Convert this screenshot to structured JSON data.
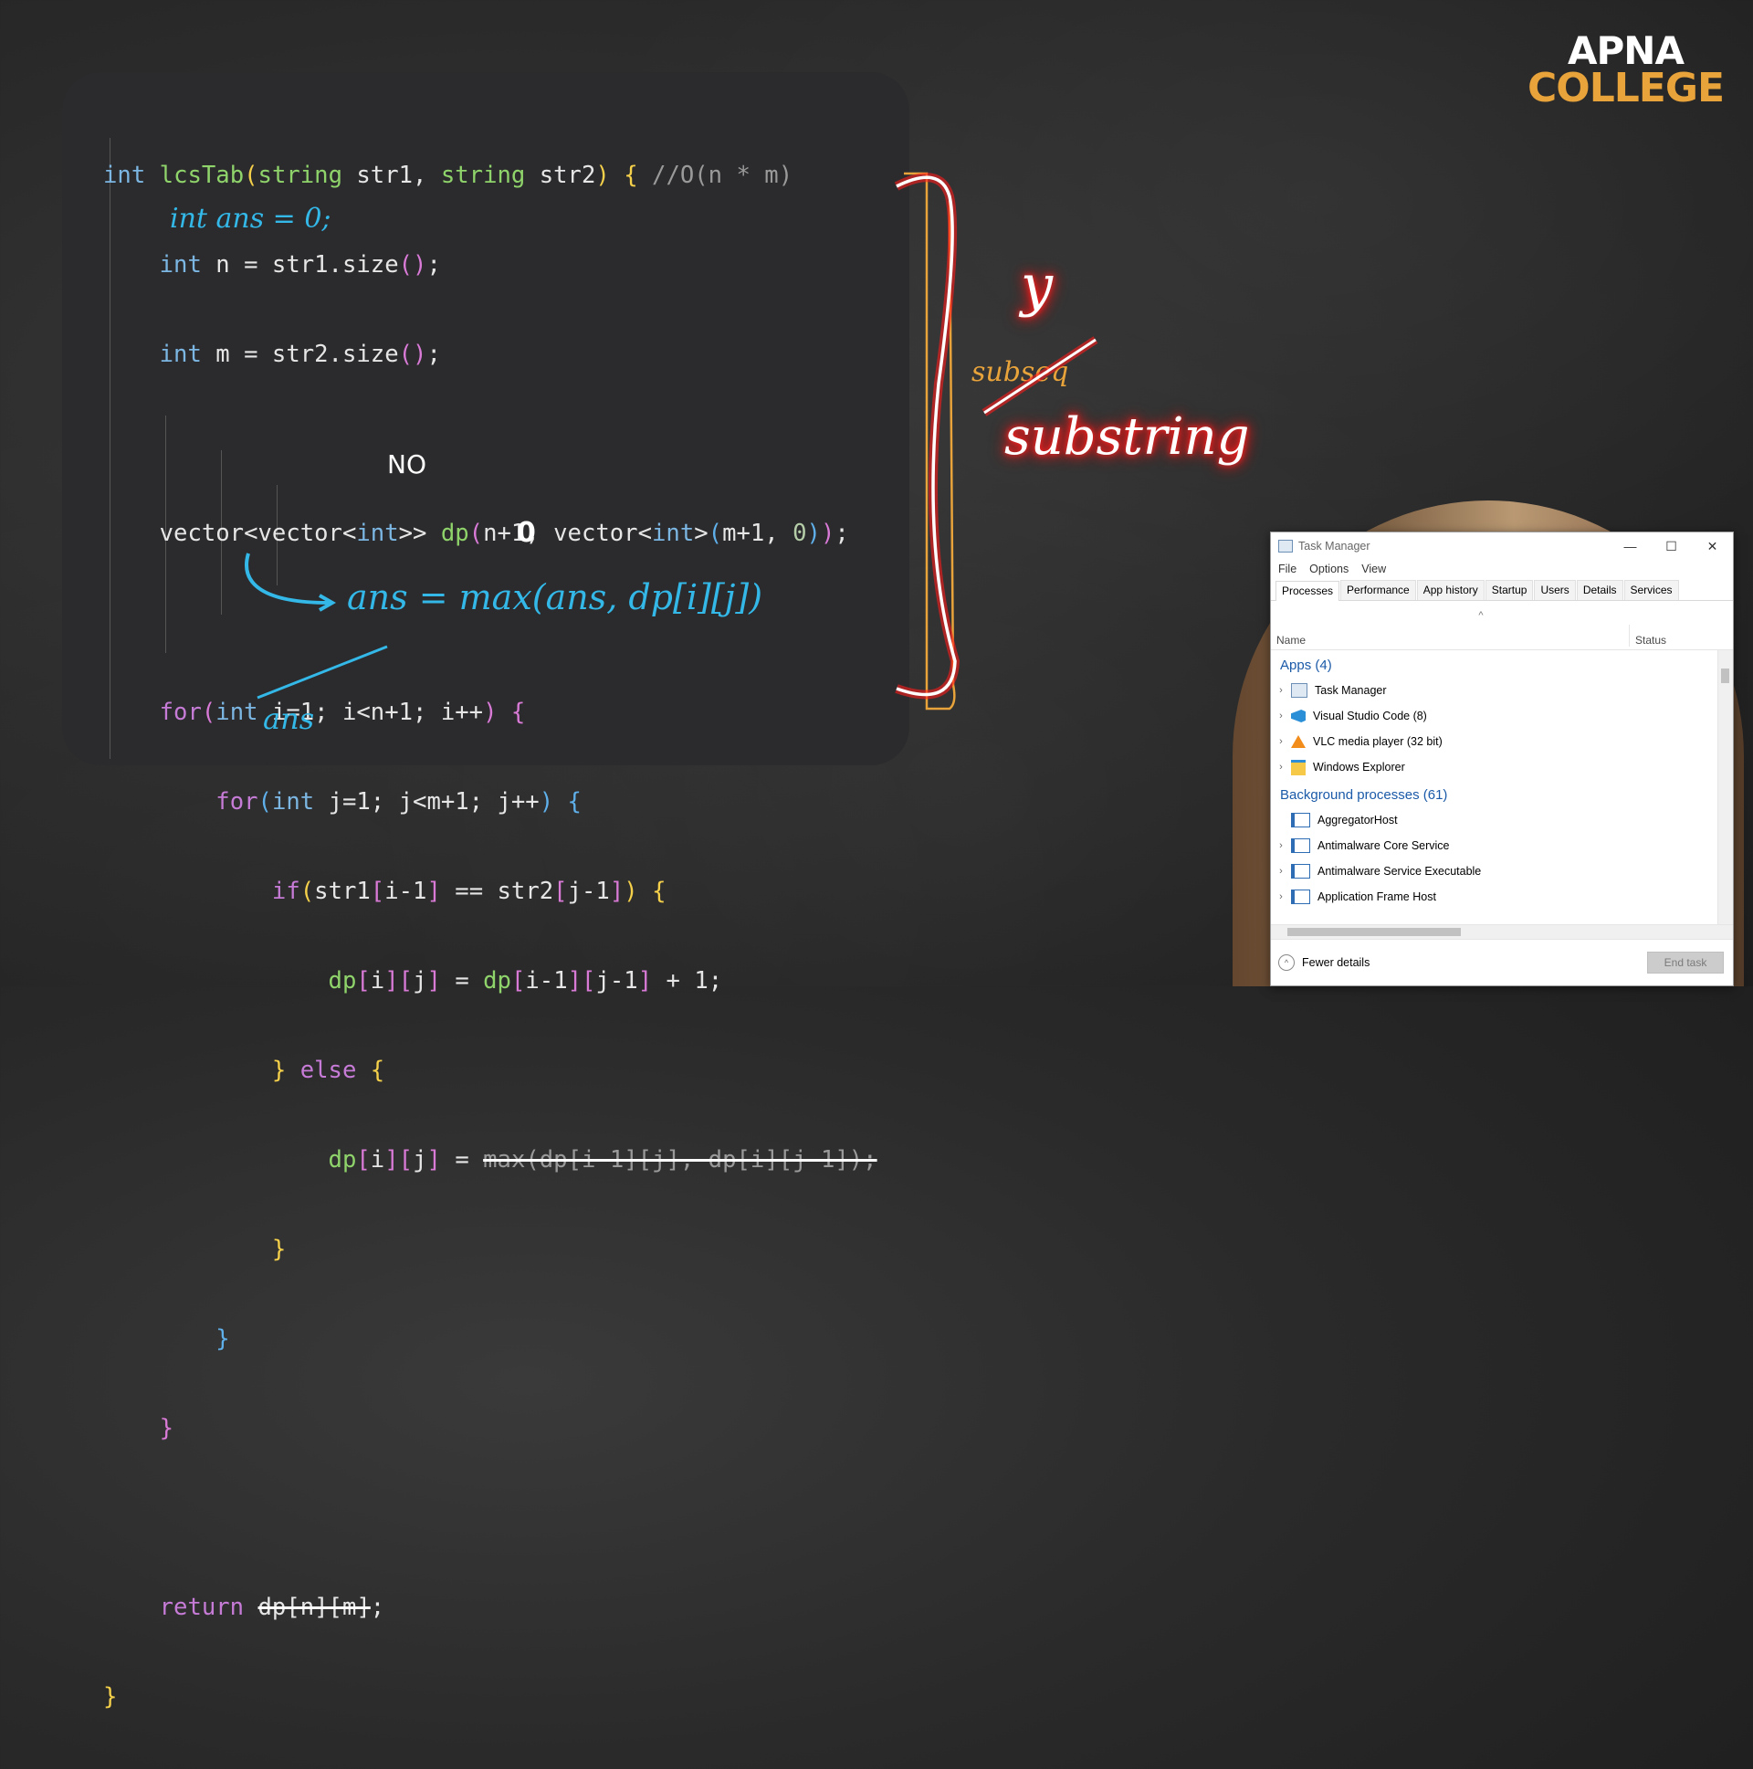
{
  "logo": {
    "line1": "APNA",
    "line2": "COLLEGE"
  },
  "code": {
    "line1": {
      "kw": "int",
      "fn": "lcsTab",
      "p1": "(",
      "t1": "string",
      "a1": " str1, ",
      "t2": "string",
      "a2": " str2",
      "p2": ")",
      "sp": " ",
      "b": "{",
      "cm": " //O(n * m)"
    },
    "line2": {
      "t": "int",
      "rest": " n = str1.size",
      "par": "()",
      "semi": ";"
    },
    "line3": {
      "t": "int",
      "rest": " m = str2.size",
      "par": "()",
      "semi": ";"
    },
    "line5": {
      "pre": "vector<vector<",
      "t1": "int",
      "mid": ">> ",
      "fn": "dp",
      "p1": "(",
      "n1": "n+1, vector<",
      "t2": "int",
      "m": ">",
      "p2": "(",
      "args": "m+1, ",
      "zero": "0",
      "p3": ")",
      "p4": ")",
      "semi": ";"
    },
    "line7": {
      "kw": "for",
      "p": "(",
      "t": "int",
      "rest": " i=1; i<n+1; i++",
      "pc": ")",
      "b": " {"
    },
    "line8": {
      "kw": "for",
      "p": "(",
      "t": "int",
      "rest": " j=1; j<m+1; j++",
      "pc": ")",
      "b": " {"
    },
    "line9": {
      "kw": "if",
      "p": "(",
      "s1": "str1",
      "i1": "[",
      "e1": "i-1",
      "i2": "]",
      "eq": " == ",
      "s2": "str2",
      "j1": "[",
      "e2": "j-1",
      "j2": "]",
      "pc": ")",
      "b": " {"
    },
    "line10": {
      "a": "dp",
      "b1": "[",
      "i": "i",
      "b2": "]",
      "b3": "[",
      "j": "j",
      "b4": "]",
      "eq": " = ",
      "c": "dp",
      "c1": "[",
      "ci": "i-1",
      "c2": "]",
      "c3": "[",
      "cj": "j-1",
      "c4": "]",
      "tail": " + 1;"
    },
    "line11": {
      "b": "}",
      "kw": " else",
      "b2": " {"
    },
    "line12": {
      "a": "dp",
      "b1": "[",
      "i": "i",
      "b2": "]",
      "b3": "[",
      "j": "j",
      "b4": "]",
      "eq": " = ",
      "struck": "max(dp[i-1][j], dp[i][j-1]);"
    },
    "line13": {
      "b": "}"
    },
    "line14": {
      "b": "}"
    },
    "line15": {
      "b": "}"
    },
    "line17": {
      "kw": "return",
      "sp": " ",
      "struck": "dp[n][m]",
      "semi": ";"
    },
    "line18": {
      "b": "}"
    }
  },
  "annotations": {
    "int_ans": "int ans = 0;",
    "no": "NO",
    "zero": "0",
    "ans_update": "ans = max(ans, dp[i][j])",
    "ans_return": "ans",
    "y": "y",
    "substring_struck": "subseq",
    "substring": "substring"
  },
  "task_manager": {
    "title": "Task Manager",
    "menu": [
      "File",
      "Options",
      "View"
    ],
    "tabs": [
      "Processes",
      "Performance",
      "App history",
      "Startup",
      "Users",
      "Details",
      "Services"
    ],
    "columns": {
      "name": "Name",
      "status": "Status"
    },
    "apps_group": "Apps (4)",
    "apps": [
      "Task Manager",
      "Visual Studio Code (8)",
      "VLC media player (32 bit)",
      "Windows Explorer"
    ],
    "bg_group": "Background processes (61)",
    "bg": [
      "AggregatorHost",
      "Antimalware Core Service",
      "Antimalware Service Executable",
      "Application Frame Host"
    ],
    "fewer_details": "Fewer details",
    "end_task": "End task"
  },
  "colors": {
    "keyword": "#c67bd6",
    "type": "#7cb7e3",
    "function": "#8fd36b",
    "bracket_yellow": "#f5d04a",
    "annotation_blue": "#33b8e8",
    "neon_red": "#ff2020",
    "logo_orange": "#e8a33a"
  }
}
